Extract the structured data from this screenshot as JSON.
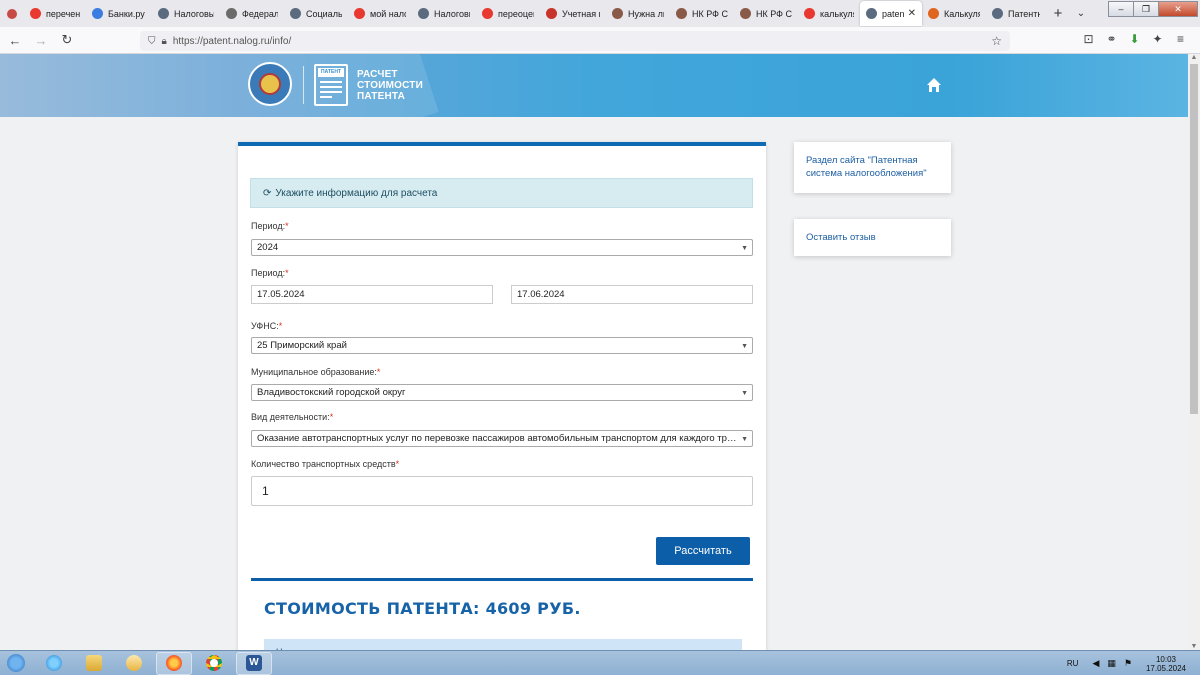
{
  "browser": {
    "tabs": [
      {
        "label": "перечень к",
        "favicon": "yandex",
        "color": "#e8382f"
      },
      {
        "label": "Банки.ру",
        "favicon": "banki",
        "color": "#3b7de0"
      },
      {
        "label": "Налоговый",
        "favicon": "globe",
        "color": "#5a6b80"
      },
      {
        "label": "Федераль",
        "favicon": "globe-dark",
        "color": "#6b6b6b"
      },
      {
        "label": "Социальн",
        "favicon": "globe",
        "color": "#5a6b80"
      },
      {
        "label": "мой налог",
        "favicon": "yandex",
        "color": "#e8382f"
      },
      {
        "label": "Налоговы",
        "favicon": "globe",
        "color": "#5a6b80"
      },
      {
        "label": "переоцен",
        "favicon": "yandex",
        "color": "#e8382f"
      },
      {
        "label": "Учетная п",
        "favicon": "flag",
        "color": "#c8342a"
      },
      {
        "label": "Нужна ли",
        "favicon": "avatar",
        "color": "#8a5a48"
      },
      {
        "label": "НК РФ Ста",
        "favicon": "avatar",
        "color": "#8a5a48"
      },
      {
        "label": "НК РФ Ста",
        "favicon": "avatar",
        "color": "#8a5a48"
      },
      {
        "label": "калькулято",
        "favicon": "yandex",
        "color": "#e8382f"
      },
      {
        "label": "patent.n",
        "favicon": "globe",
        "color": "#5a6b80",
        "active": true
      },
      {
        "label": "Калькуля",
        "favicon": "orange",
        "color": "#e0651f"
      },
      {
        "label": "Патентная",
        "favicon": "globe",
        "color": "#5a6b80"
      }
    ],
    "url": "https://patent.nalog.ru/info/",
    "new_tab_label": "+",
    "tab_list_label": "⌄"
  },
  "site": {
    "title_line1": "РАСЧЕТ",
    "title_line2": "СТОИМОСТИ",
    "title_line3": "ПАТЕНТА",
    "logo_tag": "ПАТЕНТ"
  },
  "form": {
    "info_text": "Укажите информацию для расчета",
    "period_label": "Период:",
    "period_value": "2024",
    "period2_label": "Период:",
    "date_from": "17.05.2024",
    "date_to": "17.06.2024",
    "ufns_label": "УФНС:",
    "ufns_value": "25 Приморский край",
    "municipal_label": "Муниципальное образование:",
    "municipal_value": "Владивостокский городской округ",
    "activity_label": "Вид деятельности:",
    "activity_value": "Оказание автотранспортных услуг по перевозке пассажиров автомобильным транспортом для каждого транспортного средства",
    "vehicles_label": "Количество транспортных средств",
    "vehicles_value": "1",
    "required_mark": "*",
    "calc_button": "Рассчитать"
  },
  "result": {
    "title": "СТОИМОСТЬ ПАТЕНТА: 4609 РУБ.",
    "note": "Налогоплательщики-предприниматели вправе уменьшить сумму налога, уплачиваемого в связи с применением патентной"
  },
  "sidebar": {
    "section_link": "Раздел сайта \"Патентная система налогообложения\"",
    "feedback_link": "Оставить отзыв"
  },
  "taskbar": {
    "lang": "RU",
    "time": "10:03",
    "date": "17.05.2024"
  },
  "colors": {
    "brand_blue": "#0d5ea9",
    "header_blue": "#42a6db",
    "info_bg": "#d6ecf1",
    "required_red": "#d9301f"
  }
}
